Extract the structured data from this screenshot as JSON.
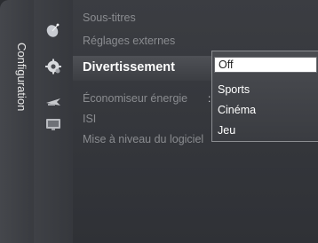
{
  "sidebar": {
    "section_label": "Configuration",
    "icons": [
      "satellite-dish-icon",
      "gear-icon",
      "plane-icon",
      "tv-screen-icon"
    ]
  },
  "menu": {
    "items": [
      {
        "label": "Sous-titres"
      },
      {
        "label": "Réglages externes"
      },
      {
        "label": "Divertissement"
      },
      {
        "label": "Économiseur énergie"
      },
      {
        "label": "ISI"
      },
      {
        "label": "Mise à niveau du logiciel"
      }
    ],
    "selected_index": 2
  },
  "dropdown": {
    "options": [
      "Off",
      "Sports",
      "Cinéma",
      "Jeu"
    ],
    "highlighted_index": 0
  }
}
